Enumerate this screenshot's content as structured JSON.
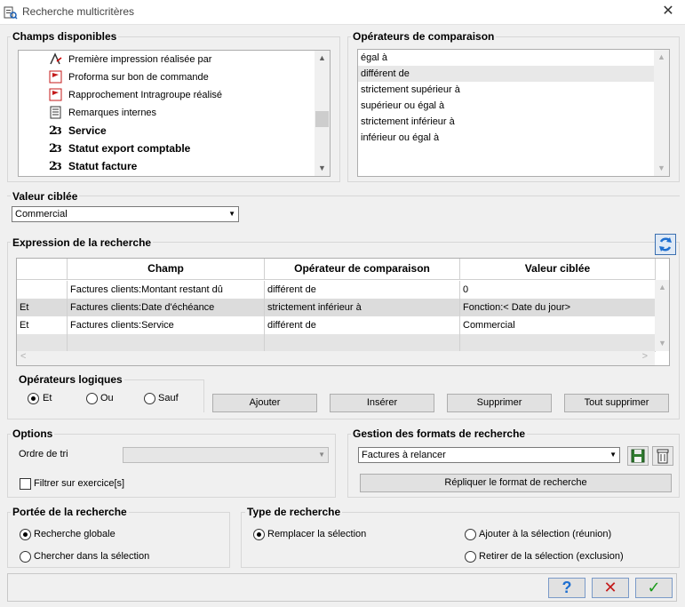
{
  "window": {
    "title": "Recherche multicritères"
  },
  "champs": {
    "title": "Champs disponibles",
    "items": [
      {
        "label": "Première impression réalisée par",
        "icon": "user-pen-icon",
        "bold": false
      },
      {
        "label": "Proforma sur bon de commande",
        "icon": "red-flag-icon",
        "bold": false
      },
      {
        "label": "Rapprochement Intragroupe réalisé",
        "icon": "red-flag-icon",
        "bold": false
      },
      {
        "label": "Remarques internes",
        "icon": "notes-icon",
        "bold": false
      },
      {
        "label": "Service",
        "icon": "enum-icon",
        "bold": true
      },
      {
        "label": "Statut export comptable",
        "icon": "enum-icon",
        "bold": true
      },
      {
        "label": "Statut facture",
        "icon": "enum-icon",
        "bold": true
      }
    ]
  },
  "operateurs": {
    "title": "Opérateurs de comparaison",
    "items": [
      "égal à",
      "différent de",
      "strictement supérieur à",
      "supérieur ou égal à",
      "strictement inférieur à",
      "inférieur ou égal à"
    ],
    "selected": "différent de"
  },
  "valeur": {
    "title": "Valeur ciblée",
    "value": "Commercial"
  },
  "expression": {
    "title": "Expression de la recherche",
    "columns": [
      "",
      "Champ",
      "Opérateur de comparaison",
      "Valeur ciblée"
    ],
    "rows": [
      [
        "",
        "Factures clients:Montant restant dû",
        "différent de",
        "0"
      ],
      [
        "Et",
        "Factures clients:Date d'échéance",
        "strictement inférieur à",
        "Fonction:< Date du jour>"
      ],
      [
        "Et",
        "Factures clients:Service",
        "différent de",
        "Commercial"
      ]
    ]
  },
  "logiques": {
    "title": "Opérateurs logiques",
    "options": [
      "Et",
      "Ou",
      "Sauf"
    ],
    "selected": "Et"
  },
  "actions": {
    "ajouter": "Ajouter",
    "inserer": "Insérer",
    "supprimer": "Supprimer",
    "tout_supprimer": "Tout supprimer"
  },
  "options": {
    "title": "Options",
    "ordre_label": "Ordre de tri",
    "ordre_value": "",
    "filtrer_label": "Filtrer sur exercice[s]",
    "filtrer_checked": false
  },
  "formats": {
    "title": "Gestion des formats de recherche",
    "value": "Factures à relancer",
    "repliquer": "Répliquer le format de recherche"
  },
  "portee": {
    "title": "Portée de la recherche",
    "options": [
      "Recherche globale",
      "Chercher dans la sélection"
    ],
    "selected": "Recherche globale"
  },
  "type": {
    "title": "Type de recherche",
    "options": [
      "Remplacer la sélection",
      "Ajouter à la sélection (réunion)",
      "Retirer de la sélection (exclusion)"
    ],
    "selected": "Remplacer la sélection"
  },
  "footer": {
    "help": "?",
    "cancel": "✕",
    "ok": "✓"
  },
  "colors": {
    "accent_green": "#1a9a1a",
    "cancel_red": "#c41b1b",
    "help_blue": "#1e6fd0",
    "selection_gray": "#dcdcdc"
  }
}
